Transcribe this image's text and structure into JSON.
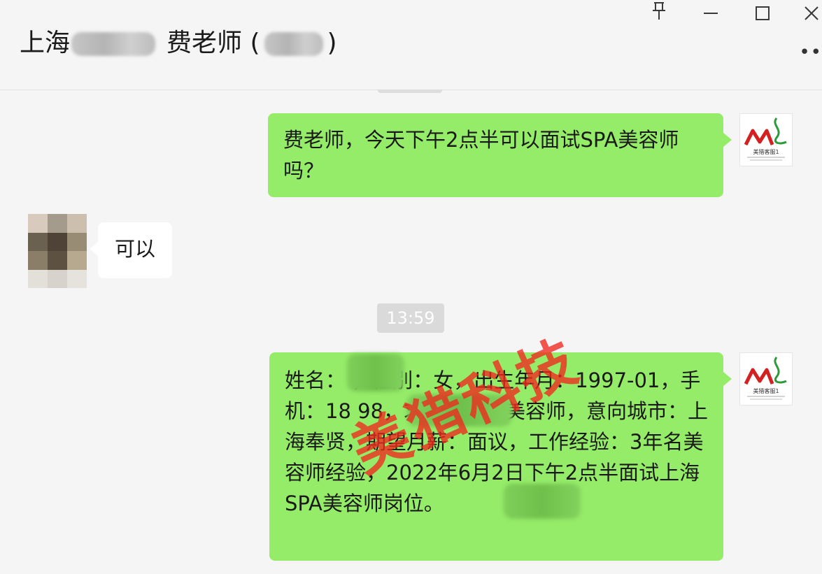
{
  "header": {
    "title_prefix": "上海",
    "title_name": "费老师 (",
    "title_suffix": ")",
    "pin_icon": "pin-icon",
    "minimize_icon": "minimize-icon",
    "maximize_icon": "maximize-icon",
    "close_icon": "close-icon",
    "more_icon": "more-icon"
  },
  "messages": [
    {
      "direction": "out",
      "text": "费老师，今天下午2点半可以面试SPA美容师吗？"
    },
    {
      "direction": "in",
      "text": "可以"
    },
    {
      "direction": "out",
      "text": "姓名：        ，性别：女，出生年月：1997-01，手机：18              98，求职岗位：美容师，意向城市：上海奉贤，期望月薪：面议，工作经验：3年名美容师经验，2022年6月2日下午2点半面试上海                SPA美容师岗位。"
    }
  ],
  "timestamp": "13:59",
  "watermark": "美猎科技",
  "logo": {
    "mark": "ML",
    "caption": "美猎客服1"
  },
  "colors": {
    "outgoing_bubble": "#95ec69",
    "incoming_bubble": "#ffffff",
    "background": "#f5f5f5",
    "watermark": "#f0281e"
  }
}
